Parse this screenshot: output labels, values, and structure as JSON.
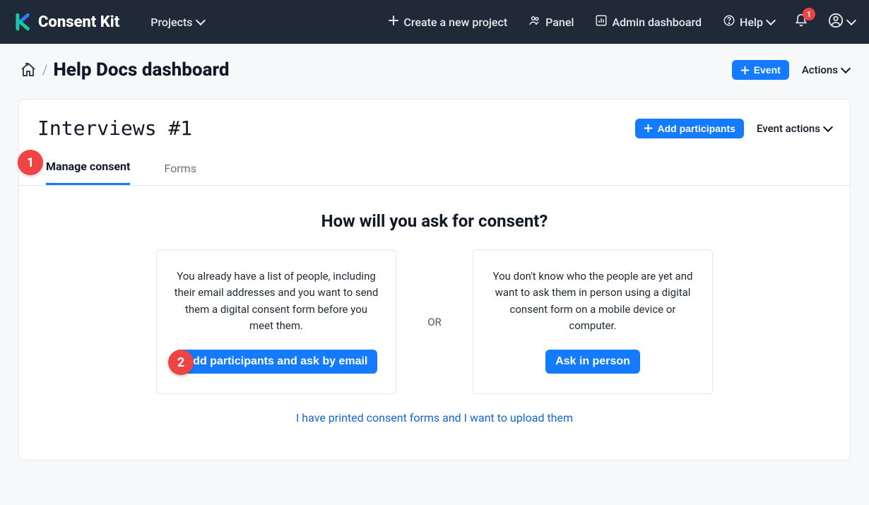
{
  "brand": {
    "name": "Consent Kit"
  },
  "nav": {
    "projects": "Projects",
    "create_project": "Create a new project",
    "panel": "Panel",
    "admin": "Admin dashboard",
    "help": "Help",
    "notifications_count": "1"
  },
  "breadcrumb": {
    "title": "Help Docs dashboard",
    "event_button": "Event",
    "actions": "Actions"
  },
  "event": {
    "title": "Interviews #1",
    "add_participants": "Add participants",
    "event_actions": "Event actions"
  },
  "tabs": {
    "manage_consent": "Manage consent",
    "forms": "Forms"
  },
  "consent": {
    "heading": "How will you ask for consent?",
    "email_desc": "You already have a list of people, including their email addresses and you want to send them a digital consent form before you meet them.",
    "email_btn": "Add participants and ask by email",
    "or": "OR",
    "inperson_desc": "You don't know who the people are yet and want to ask them in person using a digital consent form on a mobile device or computer.",
    "inperson_btn": "Ask in person",
    "upload_link": "I have printed consent forms and I want to upload them"
  },
  "annotations": {
    "step1": "1",
    "step2": "2"
  }
}
